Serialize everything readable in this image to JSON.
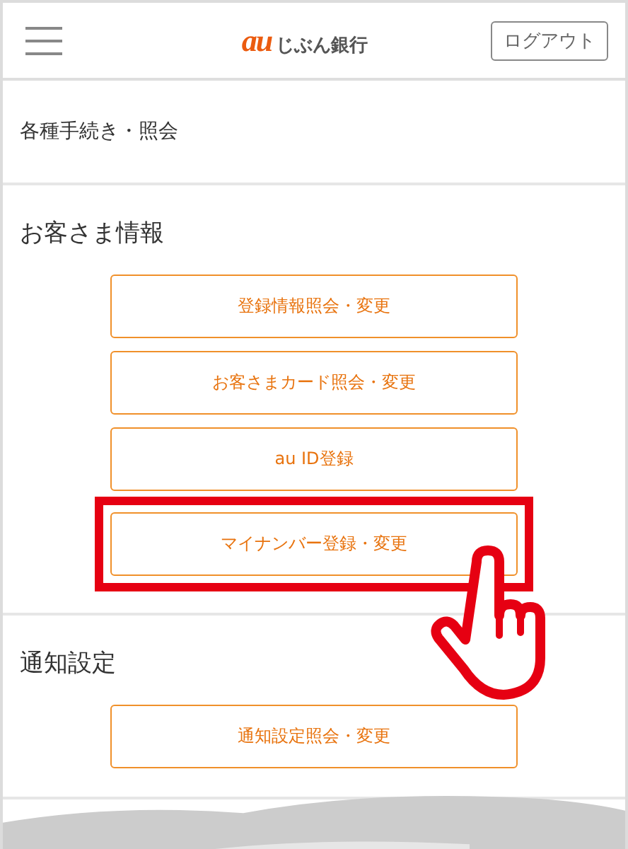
{
  "header": {
    "logo": {
      "mark": "au",
      "name": "じぶん銀行"
    },
    "logout_button": "ログアウト"
  },
  "page_title": "各種手続き・照会",
  "sections": [
    {
      "heading": "お客さま情報",
      "buttons": [
        {
          "label": "登録情報照会・変更",
          "highlighted": false
        },
        {
          "label": "お客さまカード照会・変更",
          "highlighted": false
        },
        {
          "label": "au ID登録",
          "highlighted": false
        },
        {
          "label": "マイナンバー登録・変更",
          "highlighted": true
        }
      ]
    },
    {
      "heading": "通知設定",
      "buttons": [
        {
          "label": "通知設定照会・変更",
          "highlighted": false
        }
      ]
    }
  ]
}
